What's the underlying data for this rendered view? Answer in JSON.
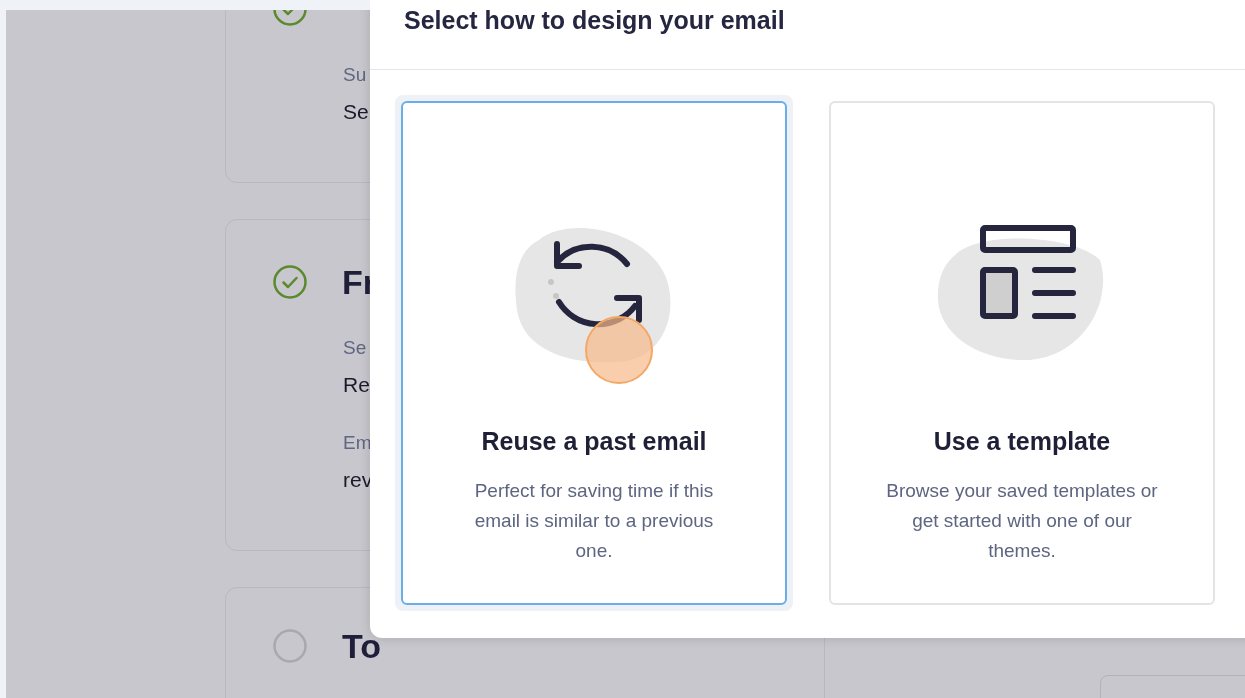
{
  "background_steps": [
    {
      "done": true,
      "fields": [
        {
          "label": "Su",
          "value": "Se"
        }
      ]
    },
    {
      "heading": "Fr",
      "done": true,
      "fields": [
        {
          "label": "Se",
          "value": "Re"
        },
        {
          "label": "Em",
          "value": "rev"
        }
      ]
    },
    {
      "heading": "To",
      "done": false
    }
  ],
  "dialog": {
    "title": "Select how to design your email",
    "options": [
      {
        "kind": "reuse",
        "title": "Reuse a past email",
        "description": "Perfect for saving time if this email is similar to a previous one.",
        "selected": true
      },
      {
        "kind": "template",
        "title": "Use a template",
        "description": "Browse your saved templates or get started with one of our themes.",
        "selected": false
      }
    ]
  }
}
